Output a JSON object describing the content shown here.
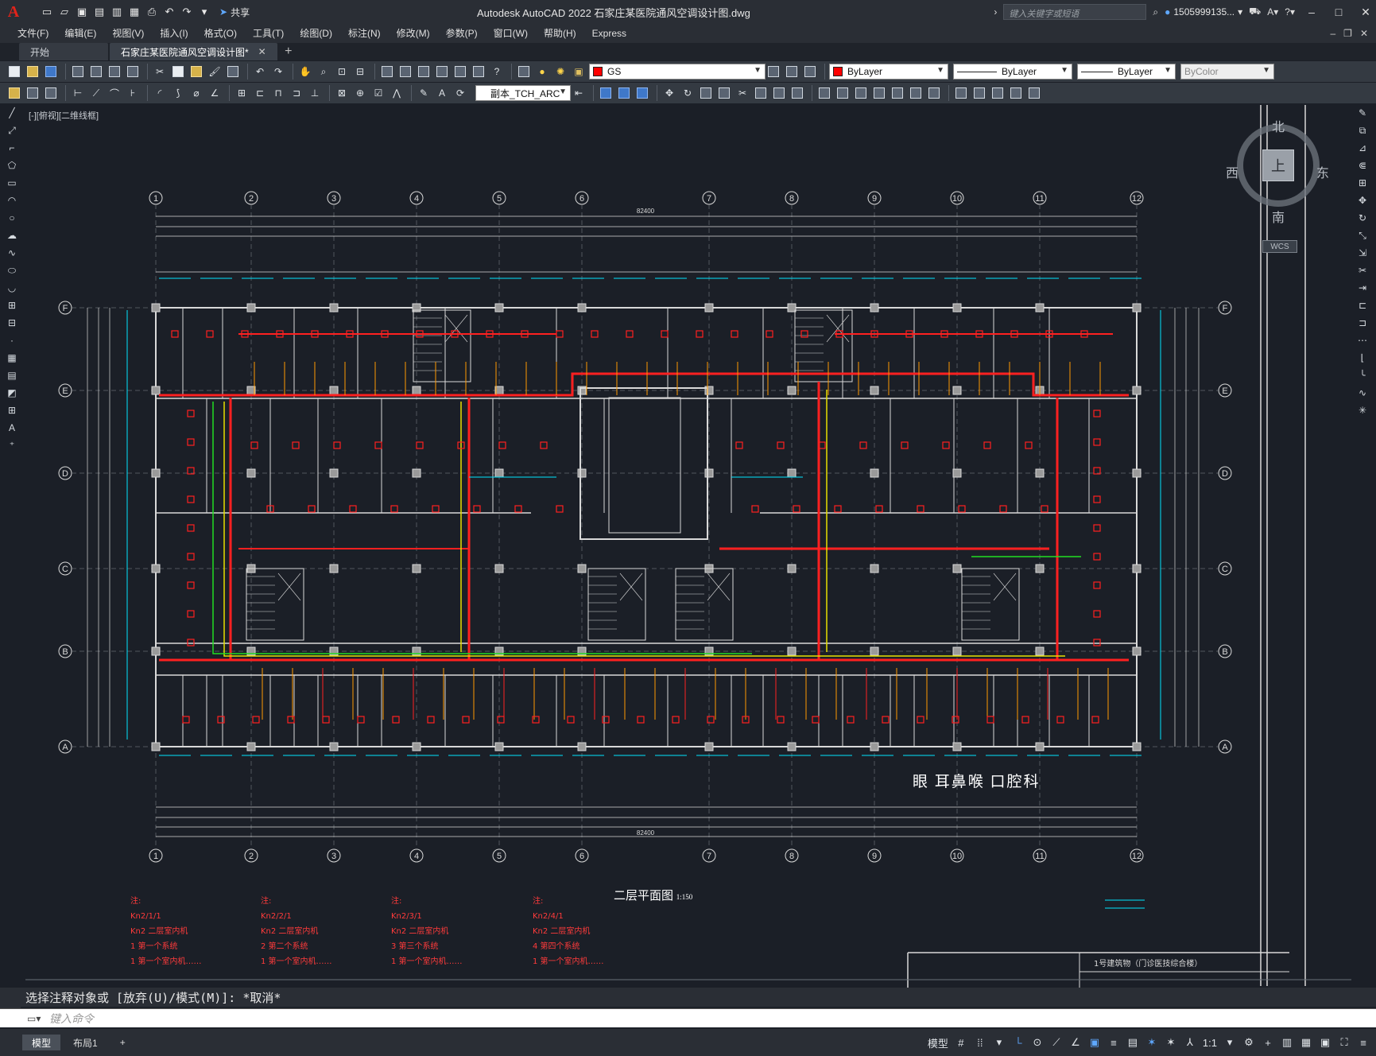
{
  "app": {
    "logo": "A",
    "title": "Autodesk AutoCAD 2022    石家庄某医院通风空调设计图.dwg",
    "share_label": "共享",
    "search_placeholder": "键入关键字或短语",
    "user": "1505999135...",
    "window_controls": [
      "–",
      "□",
      "✕"
    ]
  },
  "menu": [
    "文件(F)",
    "编辑(E)",
    "视图(V)",
    "插入(I)",
    "格式(O)",
    "工具(T)",
    "绘图(D)",
    "标注(N)",
    "修改(M)",
    "参数(P)",
    "窗口(W)",
    "帮助(H)",
    "Express"
  ],
  "tabs": {
    "start": "开始",
    "active": "石家庄某医院通风空调设计图*",
    "close": "✕",
    "add": "+"
  },
  "toolbar": {
    "layer_name": "GS",
    "color": "ByLayer",
    "linetype": "ByLayer",
    "lineweight": "ByLayer",
    "plotstyle": "ByColor",
    "textstyle": "副本_TCH_ARC"
  },
  "view_label": "[-][俯视][二维线框]",
  "viewcube": {
    "north": "北",
    "south": "南",
    "east": "东",
    "west": "西",
    "top": "上",
    "wcs": "WCS"
  },
  "drawing": {
    "floor_title": "二层平面图",
    "scale": "1:150",
    "department": "眼 耳鼻喉 口腔科",
    "grid_axes_x": [
      "1",
      "2",
      "3",
      "4",
      "5",
      "6",
      "7",
      "8",
      "9",
      "10",
      "11",
      "12"
    ],
    "grid_axes_y": [
      "F",
      "E",
      "D",
      "C",
      "B",
      "A"
    ],
    "overall_dim": "82400",
    "title_block_text": "1号建筑物（门诊医技综合楼）",
    "legends": [
      {
        "lines": [
          "注:",
          "Kn2/1/1",
          "Kn2  二层室内机",
          "1    第一个系统",
          "1    第一个室内机……"
        ]
      },
      {
        "lines": [
          "注:",
          "Kn2/2/1",
          "Kn2  二层室内机",
          "2    第二个系统",
          "1    第一个室内机……"
        ]
      },
      {
        "lines": [
          "注:",
          "Kn2/3/1",
          "Kn2  二层室内机",
          "3    第三个系统",
          "1    第一个室内机……"
        ]
      },
      {
        "lines": [
          "注:",
          "Kn2/4/1",
          "Kn2  二层室内机",
          "4    第四个系统",
          "1    第一个室内机……"
        ]
      }
    ]
  },
  "command": {
    "history": "选择注释对象或 [放弃(U)/模式(M)]: *取消*",
    "placeholder": "键入命令"
  },
  "status": {
    "layouts": [
      "模型",
      "布局1"
    ],
    "add_layout": "+",
    "model_button": "模型",
    "scale": "1:1"
  },
  "colors": {
    "background": "#1b1f27",
    "wall": "#d9d9d9",
    "duct_red": "#ff2020",
    "duct_yellow": "#e8e000",
    "pipe_cyan": "#00e5ff",
    "green": "#22dd22",
    "orange": "#ff9a00"
  }
}
